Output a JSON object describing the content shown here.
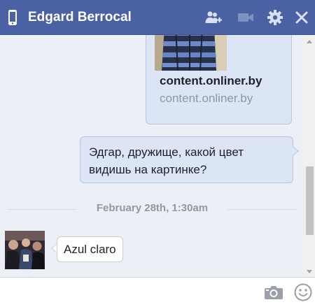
{
  "header": {
    "title": "Edgard Berrocal",
    "icons": [
      "mobile-phone-icon",
      "add-friend-icon",
      "video-call-icon",
      "settings-gear-icon",
      "close-icon"
    ]
  },
  "messages": {
    "link_preview": {
      "title": "content.onliner.by",
      "url": "content.onliner.by"
    },
    "outgoing_text": "Эдгар, дружище, какой цвет видишь на картинке?",
    "date_divider": "February 28th, 1:30am",
    "incoming_text": "Azul claro"
  },
  "composer": {
    "placeholder": "",
    "icons": [
      "camera-icon",
      "emoji-icon"
    ]
  },
  "colors": {
    "header_bg": "#4a61a3",
    "bubble_out_bg": "#dbe5f5",
    "chat_bg": "#eceff5",
    "muted_text": "#9197a3"
  }
}
